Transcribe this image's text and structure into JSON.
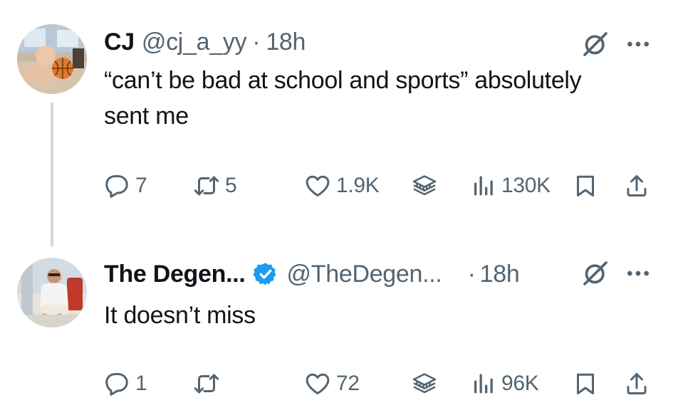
{
  "tweets": [
    {
      "name": "CJ",
      "handle": "@cj_a_yy",
      "separator": "·",
      "time": "18h",
      "text": "“can’t be bad at school and sports” absolutely sent me",
      "verified": false,
      "actions": {
        "replies": "7",
        "retweets": "5",
        "likes": "1.9K",
        "views": "130K"
      }
    },
    {
      "name": "The Degen...",
      "handle": "@TheDegen...",
      "separator": "·",
      "time": "18h",
      "text": "It doesn’t miss",
      "verified": true,
      "actions": {
        "replies": "1",
        "retweets": "",
        "likes": "72",
        "views": "96K"
      }
    }
  ],
  "icons": {
    "reply": "reply-icon",
    "retweet": "retweet-icon",
    "like": "heart-icon",
    "grok": "grok-icon",
    "views": "views-icon",
    "bookmark": "bookmark-icon",
    "share": "share-icon",
    "more": "more-icon",
    "verified": "verified-badge-icon"
  },
  "colors": {
    "text": "#0f1419",
    "secondary": "#536471",
    "verified": "#1d9bf0",
    "thread_line": "#cfd9de"
  }
}
